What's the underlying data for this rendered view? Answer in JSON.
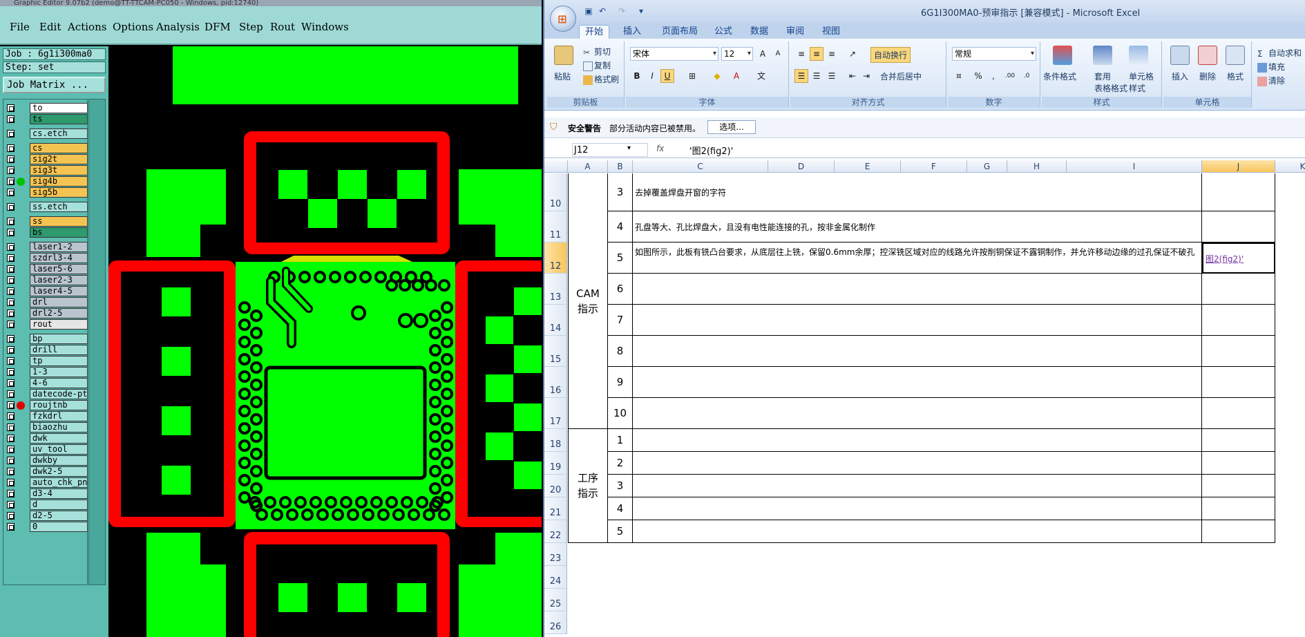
{
  "cam": {
    "title": "Graphic Editor 9.07b2 (demo@TT-TTCAM-PC050 - Windows, pid:12740)",
    "menu": [
      "File",
      "Edit",
      "Actions",
      "Options",
      "Analysis",
      "DFM",
      "Step",
      "Rout",
      "Windows"
    ],
    "job": "Job : 6g1i300ma0",
    "step": "Step: set",
    "job_matrix": "Job Matrix ...",
    "layers": [
      {
        "name": "to",
        "color": "#ffffff",
        "dot": ""
      },
      {
        "name": "ts",
        "color": "#2e9a6e",
        "dot": ""
      },
      {
        "name": "cs.etch",
        "color": "#a6e0db",
        "dot": ""
      },
      {
        "name": "cs",
        "color": "#f4c453",
        "dot": ""
      },
      {
        "name": "sig2t",
        "color": "#f4c453",
        "dot": ""
      },
      {
        "name": "sig3t",
        "color": "#f4c453",
        "dot": ""
      },
      {
        "name": "sig4b",
        "color": "#f4c453",
        "dot": "#00c000"
      },
      {
        "name": "sig5b",
        "color": "#f4c453",
        "dot": ""
      },
      {
        "name": "ss.etch",
        "color": "#a6e0db",
        "dot": ""
      },
      {
        "name": "ss",
        "color": "#f4c453",
        "dot": ""
      },
      {
        "name": "bs",
        "color": "#2e9a6e",
        "dot": ""
      },
      {
        "name": "laser1-2",
        "color": "#b8c4ce",
        "dot": ""
      },
      {
        "name": "szdrl3-4",
        "color": "#b8c4ce",
        "dot": ""
      },
      {
        "name": "laser5-6",
        "color": "#b8c4ce",
        "dot": ""
      },
      {
        "name": "laser2-3",
        "color": "#b8c4ce",
        "dot": ""
      },
      {
        "name": "laser4-5",
        "color": "#b8c4ce",
        "dot": ""
      },
      {
        "name": "drl",
        "color": "#b8c4ce",
        "dot": ""
      },
      {
        "name": "drl2-5",
        "color": "#b8c4ce",
        "dot": ""
      },
      {
        "name": "rout",
        "color": "#e6e6e6",
        "dot": ""
      },
      {
        "name": "bp",
        "color": "#a6e0db",
        "dot": ""
      },
      {
        "name": "drill",
        "color": "#a6e0db",
        "dot": ""
      },
      {
        "name": "tp",
        "color": "#a6e0db",
        "dot": ""
      },
      {
        "name": "1-3",
        "color": "#a6e0db",
        "dot": ""
      },
      {
        "name": "4-6",
        "color": "#a6e0db",
        "dot": ""
      },
      {
        "name": "datecode-pte",
        "color": "#a6e0db",
        "dot": ""
      },
      {
        "name": "roujtnb",
        "color": "#a6e0db",
        "dot": "#e00000"
      },
      {
        "name": "fzkdrl",
        "color": "#a6e0db",
        "dot": ""
      },
      {
        "name": "biaozhu",
        "color": "#a6e0db",
        "dot": ""
      },
      {
        "name": "dwk",
        "color": "#a6e0db",
        "dot": ""
      },
      {
        "name": "uv_tool",
        "color": "#a6e0db",
        "dot": ""
      },
      {
        "name": "dwkby",
        "color": "#a6e0db",
        "dot": ""
      },
      {
        "name": "dwk2-5",
        "color": "#a6e0db",
        "dot": ""
      },
      {
        "name": "auto_chk_pn",
        "color": "#a6e0db",
        "dot": ""
      },
      {
        "name": "d3-4",
        "color": "#a6e0db",
        "dot": ""
      },
      {
        "name": "d",
        "color": "#a6e0db",
        "dot": ""
      },
      {
        "name": "d2-5",
        "color": "#a6e0db",
        "dot": ""
      },
      {
        "name": "0",
        "color": "#a6e0db",
        "dot": ""
      }
    ]
  },
  "excel": {
    "title": "6G1I300MA0-预审指示 [兼容模式] - Microsoft Excel",
    "tabs": [
      "开始",
      "插入",
      "页面布局",
      "公式",
      "数据",
      "审阅",
      "视图"
    ],
    "clipboard": {
      "paste": "粘贴",
      "cut": "剪切",
      "copy": "复制",
      "format_painter": "格式刷",
      "label": "剪贴板"
    },
    "font": {
      "name": "宋体",
      "size": "12",
      "label": "字体",
      "bold": "B",
      "italic": "I",
      "underline": "U"
    },
    "alignment": {
      "wrap": "自动换行",
      "merge": "合并后居中",
      "label": "对齐方式"
    },
    "number": {
      "format": "常规",
      "label": "数字"
    },
    "styles": {
      "conditional": "条件格式",
      "table_line1": "套用",
      "table_line2": "表格格式",
      "cell_line1": "单元格",
      "cell_line2": "样式",
      "label": "样式"
    },
    "cells": {
      "insert": "插入",
      "delete": "删除",
      "format": "格式",
      "label": "单元格"
    },
    "editing": {
      "autosum": "自动求和",
      "fill": "填充",
      "clear": "清除"
    },
    "security": {
      "title": "安全警告",
      "message": "部分活动内容已被禁用。",
      "options": "选项..."
    },
    "namebox": "J12",
    "fx": "fx",
    "formula": "'图2(fig2)'",
    "columns": [
      "A",
      "B",
      "C",
      "D",
      "E",
      "F",
      "G",
      "H",
      "I",
      "J",
      "K"
    ],
    "rows": [
      {
        "num": "10",
        "b": "3",
        "c": "去掉覆盖焊盘开窗的字符",
        "j": ""
      },
      {
        "num": "11",
        "b": "4",
        "c": "孔盘等大、孔比焊盘大，且没有电性能连接的孔，按非金属化制作",
        "j": ""
      },
      {
        "num": "12",
        "b": "5",
        "c": "如图所示，此板有铣凸台要求，从底层往上铣，保留0.6mm余厚；控深铣区域对应的线路允许按削铜保证不露铜制作，并允许移动边缘的过孔保证不破孔",
        "j": "图2(fig2)'"
      },
      {
        "num": "13",
        "b": "6",
        "c": "",
        "j": ""
      },
      {
        "num": "14",
        "b": "7",
        "c": "",
        "j": ""
      },
      {
        "num": "15",
        "b": "8",
        "c": "",
        "j": ""
      },
      {
        "num": "16",
        "b": "9",
        "c": "",
        "j": ""
      },
      {
        "num": "17",
        "b": "10",
        "c": "",
        "j": ""
      },
      {
        "num": "18",
        "b": "1",
        "c": "",
        "j": ""
      },
      {
        "num": "19",
        "b": "2",
        "c": "",
        "j": ""
      },
      {
        "num": "20",
        "b": "3",
        "c": "",
        "j": ""
      },
      {
        "num": "21",
        "b": "4",
        "c": "",
        "j": ""
      },
      {
        "num": "22",
        "b": "5",
        "c": "",
        "j": ""
      },
      {
        "num": "23",
        "b": "",
        "c": "",
        "j": ""
      },
      {
        "num": "24",
        "b": "",
        "c": "",
        "j": ""
      },
      {
        "num": "25",
        "b": "",
        "c": "",
        "j": ""
      },
      {
        "num": "26",
        "b": "",
        "c": "",
        "j": ""
      }
    ],
    "group_cam": "CAM\n指示",
    "group_process": "工序\n指示"
  }
}
